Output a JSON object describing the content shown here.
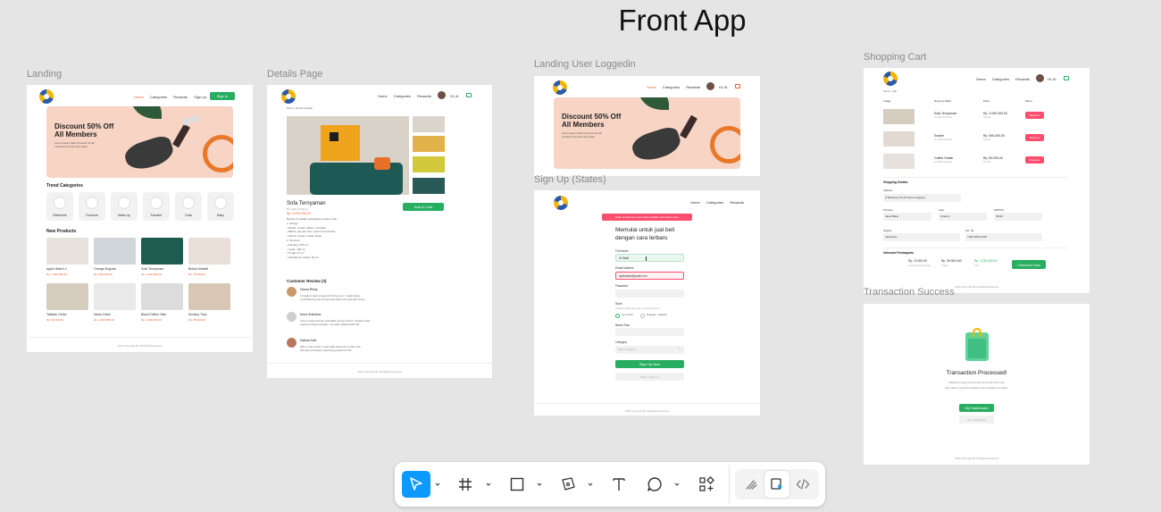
{
  "canvas": {
    "title": "Front App"
  },
  "frames": {
    "landing": {
      "label": "Landing",
      "nav": [
        "Home",
        "Categories",
        "Rewards",
        "Sign Up"
      ],
      "cta": "Sign In",
      "banner_title_1": "Discount 50% Off",
      "banner_title_2": "All Members",
      "banner_sub": "Lorem ipsum dolor sit amet for all members of store this week",
      "trend_title": "Trend Categories",
      "categories": [
        "Elektronik",
        "Furniture",
        "Make Up",
        "Sneaker",
        "Tools",
        "Baby"
      ],
      "new_title": "New Products",
      "products": [
        {
          "name": "Apple Watch 4",
          "price": "Rp. 1.000.000,00"
        },
        {
          "name": "Orange Bogotta",
          "price": "Rp. 500.000,00"
        },
        {
          "name": "Sofa Ternyaman",
          "price": "Rp. 3.000.000,00"
        },
        {
          "name": "Bubuk Maketti",
          "price": "Rp. 75.000,00"
        },
        {
          "name": "Tatakan Gelas",
          "price": "Rp. 50.000,00"
        },
        {
          "name": "Mavic Kawe",
          "price": "Rp. 4.000.000,00"
        },
        {
          "name": "Black Edition Nike",
          "price": "Rp. 1.500.000,00"
        },
        {
          "name": "Monkey Toys",
          "price": "Rp. 85.000,00"
        }
      ],
      "footer": "2020 Copyright Bv. All Rights Reserved"
    },
    "details": {
      "label": "Details Page",
      "nav": [
        "Home",
        "Categories",
        "Rewards"
      ],
      "greet": "Hi, Al",
      "breadcrumb": [
        "Home",
        "/",
        "Product Details"
      ],
      "product_name": "Sofa Ternyaman",
      "product_sub": "By Galih Pratama",
      "price": "Rp. 3.000.000,00",
      "add_btn": "Add to Cart",
      "desc_lines": [
        "Berikut ini adalah spesifikasi produk untuk:",
        "1. Design:",
        "    • Model: modern black, minimalis",
        "    • Bahan: jati asli, kain, kulit & 3d oriented",
        "    • Warna: merah, coklat, hitam",
        "2. Dimensi:",
        "    • Panjang: 300 cm",
        "    • Lebar: 100 cm",
        "    • Tinggi: 91 cm",
        "    • Kedalaman duduk: 60 cm"
      ],
      "reviews_title": "Customer Review (3)",
      "reviews": [
        {
          "name": "Hazza Risky",
          "text": [
            "I thought it was not good for living room. I really happy",
            "to decided buy this product last week now feels like homey."
          ]
        },
        {
          "name": "Anna Sukkieva",
          "text": [
            "Color is great with the minimalist concept. Even I thought it was",
            "made by Cactus Industry. I do really satisfied with this."
          ]
        },
        {
          "name": "Dakota Noir",
          "text": [
            "When I saw at first, it was really awesome to have with.",
            "Just felt so inviting it was being product for this."
          ]
        }
      ],
      "footer": "2020 Copyright Bv. All Rights Reserved"
    },
    "landing_user": {
      "label": "Landing User Loggedin",
      "nav": [
        "Home",
        "Categories",
        "Rewards"
      ],
      "greet": "Hi, Al",
      "banner_title_1": "Discount 50% Off",
      "banner_title_2": "All Members",
      "banner_sub": "Lorem ipsum dolor sit amet for all members of store this week"
    },
    "signup": {
      "label": "Sign Up (States)",
      "nav": [
        "Home",
        "Categories",
        "Rewards"
      ],
      "error": "Maaf, tampaknya email sudah terdaftar pada sistem kami",
      "heading_1": "Memulai untuk jual beli",
      "heading_2": "dengan cara terbaru",
      "full_name_label": "Full Name",
      "full_name_value": "Al Sadri",
      "email_label": "Email Address",
      "email_value": "ayahsadri@gmail.com",
      "password_label": "Password",
      "store_label": "Store",
      "store_hint": "Apakah anda juga ingin membuka toko?",
      "radio_yes": "Iya, boleh",
      "radio_no": "Enggak, makasih",
      "store_name_label": "Nama Toko",
      "category_label": "Category",
      "category_placeholder": "Select Category",
      "signup_btn": "Sign Up Now",
      "signin_btn": "Back to Sign In",
      "footer": "2020 Copyright Bv. All Rights Reserved"
    },
    "cart": {
      "label": "Shopping Cart",
      "nav": [
        "Home",
        "Categories",
        "Rewards"
      ],
      "greet": "Hi, Al",
      "breadcrumb": [
        "Home",
        "/",
        "Cart"
      ],
      "headers": [
        "Image",
        "Name & Seller",
        "Price",
        "Menu"
      ],
      "items": [
        {
          "name": "Sofa Ternyaman",
          "seller": "by Galih Pratama",
          "price": "Rp. 3.000.000,00",
          "unit": "Rupiah",
          "menu": "Remove"
        },
        {
          "name": "Snaker",
          "seller": "by Galih Pratama",
          "price": "Rp. 550.000,00",
          "unit": "Rupiah",
          "menu": "Remove"
        },
        {
          "name": "Coffee Holder",
          "seller": "by Galih Pratama",
          "price": "Rp. 50.000,00",
          "unit": "Rupiah",
          "menu": "Remove"
        }
      ],
      "shipping_title": "Shipping Details",
      "address_label": "Address",
      "address_value": "Jl Bandeng No.25 Desa Jungjung",
      "province_label": "Province",
      "province_value": "Jawa Barat",
      "city_label": "Kota",
      "city_value": "Cirebon",
      "zip_label": "ZIP/POS",
      "zip_value": "45112",
      "country_label": "Negara",
      "country_value": "Indonesia",
      "phone_label": "NO. Hp",
      "phone_value": "+628 2833 2018",
      "payment_title": "Informasi Pembayaran",
      "pay_1": "Rp. 10.000,00",
      "pay_1_sub": "Asuransi Perlindungan",
      "pay_2": "Rp. 30.000,000",
      "pay_2_sub": "Ongkir",
      "pay_3": "Rp. 3.240.000,00",
      "pay_3_sub": "Total",
      "checkout_btn": "Checkout Now",
      "footer": "2020 Copyright Bv. All Rights Reserved"
    },
    "success": {
      "label": "Transaction Success",
      "heading": "Transaction Processed!",
      "sub_1": "Silahkan tunggu konfirmasi email dari kami dan",
      "sub_2": "kami akan menginformasikan resi sesegera mungkin!",
      "dashboard_btn": "My Dashboard",
      "shopping_btn": "Go to Shopping",
      "footer": "2020 Copyright Bv. All Rights Reserved"
    }
  },
  "toolbar": {
    "tools": [
      "move-tool",
      "frame-tool",
      "rectangle-tool",
      "pen-tool",
      "text-tool",
      "comment-tool",
      "assets-tool"
    ],
    "modes": [
      "draw-mode",
      "design-mode",
      "dev-mode"
    ],
    "accent": "#0d99ff"
  },
  "colors": {
    "green": "#27ae60",
    "orange": "#f15a29",
    "pink": "#ff4d6d",
    "canvas": "#e5e5e5"
  }
}
